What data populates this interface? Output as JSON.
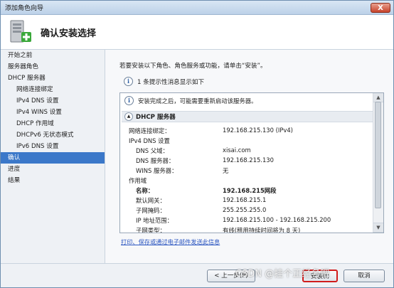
{
  "window": {
    "title": "添加角色向导",
    "close_glyph": "X"
  },
  "header": {
    "title": "确认安装选择",
    "icon": "server-add-icon"
  },
  "sidebar": {
    "items": [
      {
        "label": "开始之前",
        "sub": false,
        "active": false
      },
      {
        "label": "服务器角色",
        "sub": false,
        "active": false
      },
      {
        "label": "DHCP 服务器",
        "sub": false,
        "active": false
      },
      {
        "label": "网络连接绑定",
        "sub": true,
        "active": false
      },
      {
        "label": "IPv4 DNS 设置",
        "sub": true,
        "active": false
      },
      {
        "label": "IPv4 WINS 设置",
        "sub": true,
        "active": false
      },
      {
        "label": "DHCP 作用域",
        "sub": true,
        "active": false
      },
      {
        "label": "DHCPv6 无状态模式",
        "sub": true,
        "active": false
      },
      {
        "label": "IPv6 DNS 设置",
        "sub": true,
        "active": false
      },
      {
        "label": "确认",
        "sub": false,
        "active": true
      },
      {
        "label": "进度",
        "sub": false,
        "active": false
      },
      {
        "label": "结果",
        "sub": false,
        "active": false
      }
    ]
  },
  "main": {
    "intro": "若要安装以下角色、角色服务或功能，请单击“安装”。",
    "message_count": "1 条提示性消息显示如下",
    "info_glyph": "i",
    "note": "安装完成之后，可能需要重新启动该服务器。",
    "section_title": "DHCP 服务器",
    "section_chevron": "▲",
    "details": {
      "binding_label": "网络连接绑定：",
      "binding_value": "192.168.215.130 (IPv4)",
      "dns_settings_label": "IPv4 DNS 设置",
      "dns_parent_label": "DNS 父域：",
      "dns_parent_value": "xisai.com",
      "dns_server_label": "DNS 服务器：",
      "dns_server_value": "192.168.215.130",
      "wins_label": "WINS 服务器：",
      "wins_value": "无",
      "scope_label": "作用域",
      "name_label": "名称：",
      "name_value": "192.168.215网段",
      "gateway_label": "默认网关：",
      "gateway_value": "192.168.215.1",
      "subnet_label": "子网掩码：",
      "subnet_value": "255.255.255.0",
      "range_label": "IP 地址范围：",
      "range_value": "192.168.215.100 - 192.168.215.200",
      "subnet_type_label": "子网类型：",
      "subnet_type_value": "有线(租用持续时间将为 8 天)"
    },
    "link": "打印、保存或通过电子邮件发送此信息"
  },
  "footer": {
    "prev_label": "< 上一步(P)",
    "install_label": "安装(I)",
    "cancel_label": "取消"
  },
  "watermark": "CSDN @挂个正经名吧"
}
